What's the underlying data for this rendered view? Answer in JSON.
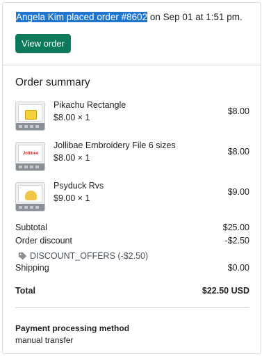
{
  "headline": {
    "selected_text": "Angela Kim placed order #8602",
    "rest_text": " on Sep 01 at 1:51 pm."
  },
  "view_order_label": "View order",
  "order_summary": {
    "title": "Order summary",
    "items": [
      {
        "name": "Pikachu Rectangle",
        "qty": "$8.00 × 1",
        "price": "$8.00",
        "thumb": "pikachu-thumbnail"
      },
      {
        "name": "Jollibae Embroidery File 6 sizes",
        "qty": "$8.00 × 1",
        "price": "$8.00",
        "thumb": "jollibee-thumbnail",
        "thumb_text": "Jollibee"
      },
      {
        "name": "Psyduck Rvs",
        "qty": "$9.00 × 1",
        "price": "$9.00",
        "thumb": "psyduck-thumbnail"
      }
    ]
  },
  "totals": {
    "subtotal_label": "Subtotal",
    "subtotal_value": "$25.00",
    "discount_label": "Order discount",
    "discount_value": "-$2.50",
    "discount_code": "DISCOUNT_OFFERS (-$2.50)",
    "shipping_label": "Shipping",
    "shipping_value": "$0.00",
    "total_label": "Total",
    "total_value": "$22.50 USD"
  },
  "payment": {
    "title": "Payment processing method",
    "value": "manual transfer"
  },
  "colors": {
    "primary_button": "#0b7a5b",
    "selection": "#1f76d1"
  }
}
